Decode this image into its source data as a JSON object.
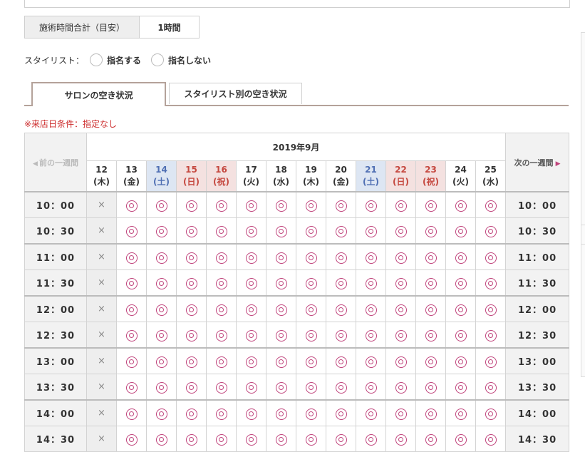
{
  "duration": {
    "label": "施術時間合計（目安）",
    "value": "1時間"
  },
  "stylist": {
    "label": "スタイリスト：",
    "options": [
      "指名する",
      "指名しない"
    ]
  },
  "tabs": [
    "サロンの空き状況",
    "スタイリスト別の空き状況"
  ],
  "condition": "※来店日条件：指定なし",
  "calendar": {
    "month": "2019年9月",
    "prev_label": "前の一週間",
    "next_label": "次の一週間",
    "days": [
      {
        "date": "12",
        "dow": "(木)",
        "type": "weekday"
      },
      {
        "date": "13",
        "dow": "(金)",
        "type": "weekday"
      },
      {
        "date": "14",
        "dow": "(土)",
        "type": "sat"
      },
      {
        "date": "15",
        "dow": "(日)",
        "type": "hol"
      },
      {
        "date": "16",
        "dow": "(祝)",
        "type": "hol"
      },
      {
        "date": "17",
        "dow": "(火)",
        "type": "weekday"
      },
      {
        "date": "18",
        "dow": "(水)",
        "type": "weekday"
      },
      {
        "date": "19",
        "dow": "(木)",
        "type": "weekday"
      },
      {
        "date": "20",
        "dow": "(金)",
        "type": "weekday"
      },
      {
        "date": "21",
        "dow": "(土)",
        "type": "sat"
      },
      {
        "date": "22",
        "dow": "(日)",
        "type": "hol"
      },
      {
        "date": "23",
        "dow": "(祝)",
        "type": "hol"
      },
      {
        "date": "24",
        "dow": "(火)",
        "type": "weekday"
      },
      {
        "date": "25",
        "dow": "(水)",
        "type": "weekday"
      }
    ],
    "times": [
      "10：00",
      "10：30",
      "11：00",
      "11：30",
      "12：00",
      "12：30",
      "13：00",
      "13：30",
      "14：00",
      "14：30"
    ],
    "unavailable_symbol": "×",
    "availability": [
      [
        "x",
        "o",
        "o",
        "o",
        "o",
        "o",
        "o",
        "o",
        "o",
        "o",
        "o",
        "o",
        "o",
        "o"
      ],
      [
        "x",
        "o",
        "o",
        "o",
        "o",
        "o",
        "o",
        "o",
        "o",
        "o",
        "o",
        "o",
        "o",
        "o"
      ],
      [
        "x",
        "o",
        "o",
        "o",
        "o",
        "o",
        "o",
        "o",
        "o",
        "o",
        "o",
        "o",
        "o",
        "o"
      ],
      [
        "x",
        "o",
        "o",
        "o",
        "o",
        "o",
        "o",
        "o",
        "o",
        "o",
        "o",
        "o",
        "o",
        "o"
      ],
      [
        "x",
        "o",
        "o",
        "o",
        "o",
        "o",
        "o",
        "o",
        "o",
        "o",
        "o",
        "o",
        "o",
        "o"
      ],
      [
        "x",
        "o",
        "o",
        "o",
        "o",
        "o",
        "o",
        "o",
        "o",
        "o",
        "o",
        "o",
        "o",
        "o"
      ],
      [
        "x",
        "o",
        "o",
        "o",
        "o",
        "o",
        "o",
        "o",
        "o",
        "o",
        "o",
        "o",
        "o",
        "o"
      ],
      [
        "x",
        "o",
        "o",
        "o",
        "o",
        "o",
        "o",
        "o",
        "o",
        "o",
        "o",
        "o",
        "o",
        "o"
      ],
      [
        "x",
        "o",
        "o",
        "o",
        "o",
        "o",
        "o",
        "o",
        "o",
        "o",
        "o",
        "o",
        "o",
        "o"
      ],
      [
        "x",
        "o",
        "o",
        "o",
        "o",
        "o",
        "o",
        "o",
        "o",
        "o",
        "o",
        "o",
        "o",
        "o"
      ]
    ]
  },
  "colors": {
    "available": "#c0447c",
    "saturday_bg": "#dde6f3",
    "holiday_bg": "#f4e1e0",
    "notice": "#cc2b2b"
  }
}
